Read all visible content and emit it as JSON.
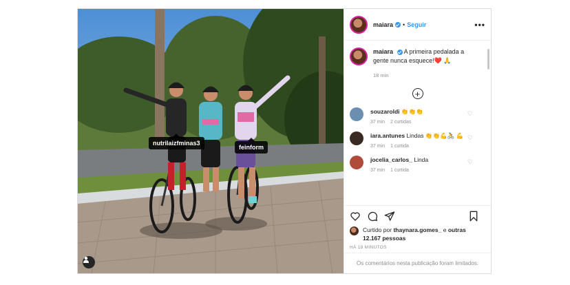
{
  "post": {
    "username": "maiara",
    "separator": "•",
    "follow_label": "Seguir",
    "more_label": "•••",
    "caption_text": "A primeira pedalada a gente nunca esquece!❤️ 🙏",
    "caption_time": "18 min",
    "load_more_label": "+",
    "photo_tags": [
      "nutrilaizfminas3",
      "feinform"
    ]
  },
  "comments": [
    {
      "user": "souzaroldi",
      "text": "👏👏👏",
      "time": "37 min",
      "likes": "2 curtidas",
      "avatar_color": "#6a8fb0"
    },
    {
      "user": "iara.antunes",
      "text": "Lindas 👏👏💪🚴 💪",
      "time": "37 min",
      "likes": "1 curtida",
      "avatar_color": "#3a2a24"
    },
    {
      "user": "jocelia_carlos_",
      "text": "Linda",
      "time": "37 min",
      "likes": "1 curtida",
      "avatar_color": "#b04a3a"
    }
  ],
  "actions": {
    "like_icon": "heart-icon",
    "comment_icon": "comment-icon",
    "share_icon": "send-icon",
    "save_icon": "bookmark-icon"
  },
  "likes": {
    "prefix": "Curtido por",
    "liker": "thaynara.gomes_",
    "conjunction": "e",
    "others": "outras 12.167 pessoas"
  },
  "time_ago": "HÁ 18 MINUTOS",
  "comments_limited": "Os comentários nesta publicação foram limitados.",
  "colors": {
    "accent": "#3897f0",
    "text": "#262626",
    "muted": "#8e8e8e",
    "border": "#dbdbdb"
  }
}
